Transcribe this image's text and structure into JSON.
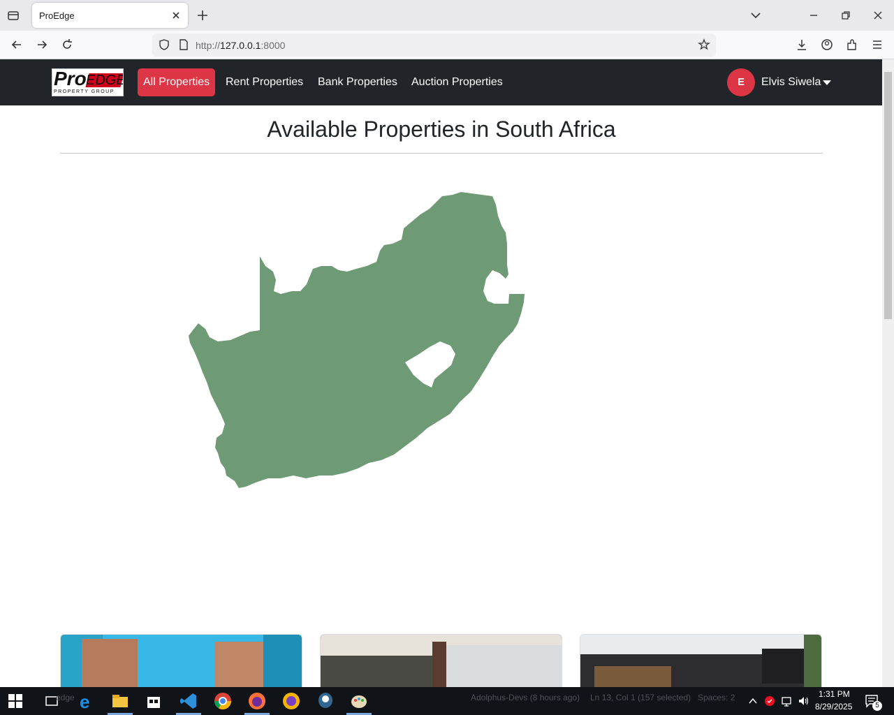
{
  "browser": {
    "tab_title": "ProEdge",
    "url_prefix": "http://",
    "url_host": "127.0.0.1",
    "url_port": ":8000"
  },
  "site_nav": {
    "links": [
      {
        "label": "All Properties",
        "active": true
      },
      {
        "label": "Rent Properties",
        "active": false
      },
      {
        "label": "Bank Properties",
        "active": false
      },
      {
        "label": "Auction Properties",
        "active": false
      }
    ],
    "user_initial": "E",
    "user_name": "Elvis Siwela"
  },
  "logo": {
    "text_pro": "Pro",
    "text_edge": "EDGE",
    "tagline": "PROPERTY GROUP"
  },
  "page": {
    "heading": "Available Properties in South Africa"
  },
  "map": {
    "fill_color": "#6f9a76"
  },
  "taskbar": {
    "ghost_left": "edge",
    "ghost_mid1": "Adolphus-Devs (8 hours ago)",
    "ghost_mid2": "Ln 13, Col 1 (157 selected)",
    "ghost_mid3": "Spaces: 2",
    "time": "1:31 PM",
    "date": "8/29/2025",
    "notif_count": "5"
  },
  "colors": {
    "accent": "#dc3545",
    "navbar": "#212529"
  }
}
